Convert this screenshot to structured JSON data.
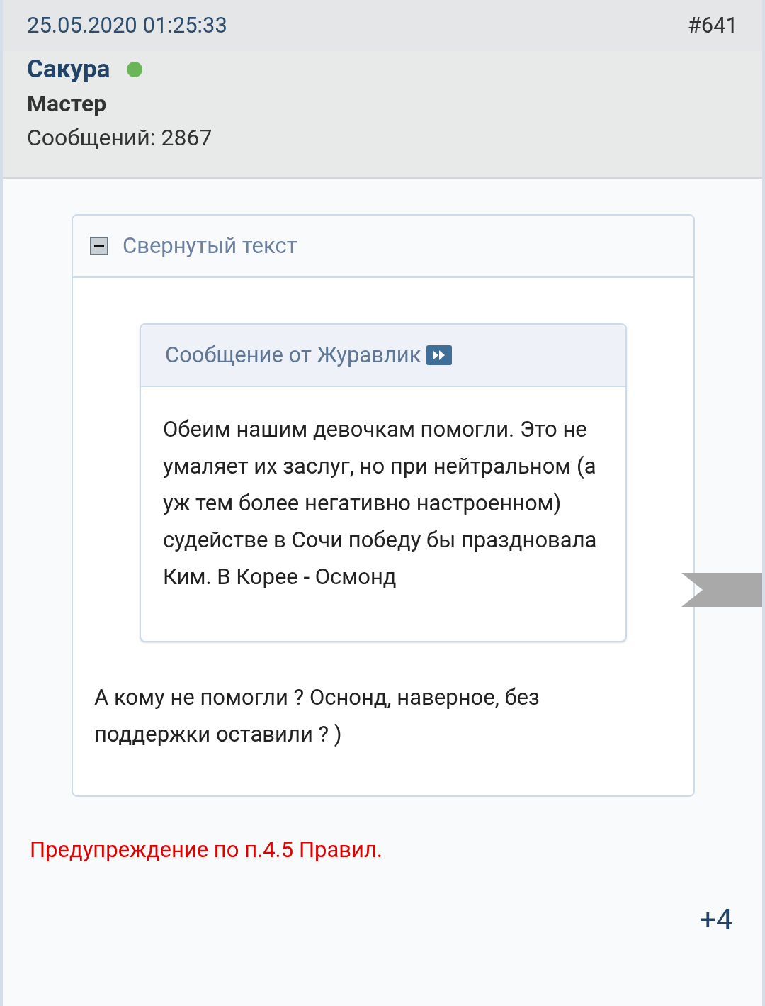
{
  "post": {
    "datetime": "25.05.2020 01:25:33",
    "number": "#641"
  },
  "author": {
    "name": "Сакура",
    "online": true,
    "rank": "Мастер",
    "posts": "Сообщений: 2867"
  },
  "spoiler": {
    "title": "Свернутый текст",
    "expanded": true
  },
  "quote": {
    "header": "Сообщение от Журавлик",
    "text": "Обеим нашим девочкам помогли. Это не умаляет их заслуг, но при нейтральном (а уж тем более негативно настроенном) судействе в Сочи победу бы праздновала Ким. В Корее - Осмонд"
  },
  "reply": "А кому не помогли ? Оснонд, наверное, без поддержки оставили ? )",
  "moderator_note": "Предупреждение по п.4.5 Правил.",
  "rating": "+4"
}
